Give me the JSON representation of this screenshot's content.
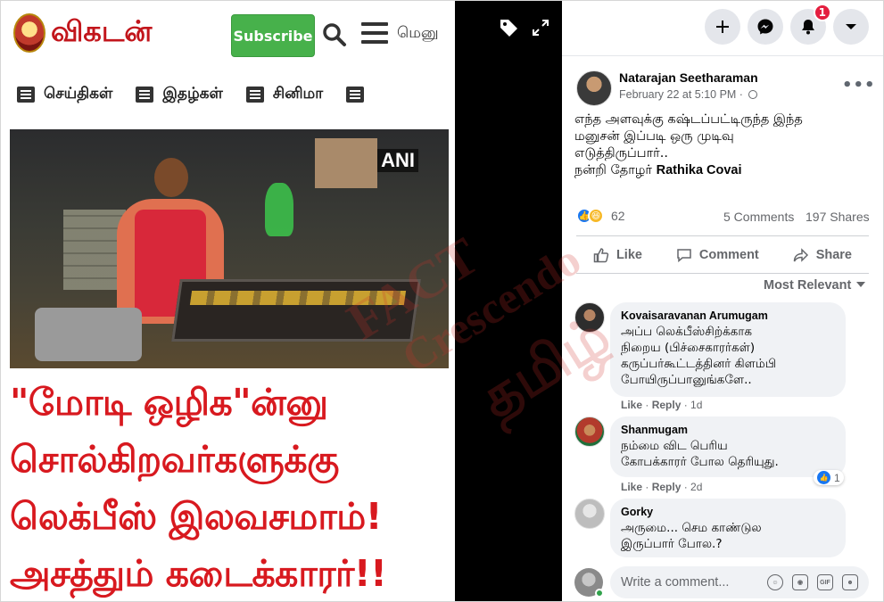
{
  "left_image": {
    "logo_text": "விகடன்",
    "subscribe_label": "Subscribe",
    "menu_label": "மெனு",
    "nav": [
      {
        "label": "செய்திகள்",
        "icon": "news-icon"
      },
      {
        "label": "இதழ்கள்",
        "icon": "book-icon"
      },
      {
        "label": "சினிமா",
        "icon": "film-icon"
      }
    ],
    "photo_credit": "ANI",
    "headline": [
      "\"மோடி ஒழிக\"ன்னு",
      "சொல்கிறவர்களுக்கு",
      "லெக்பீஸ் இலவசமாம்!",
      "அசத்தும் கடைக்காரர்!!"
    ],
    "headline_color": "#d8191f",
    "subscribe_color": "#47b14b"
  },
  "topbar": {
    "notifications_badge": "1",
    "buttons": [
      "plus-icon",
      "messenger-icon",
      "bell-icon",
      "caret-down-icon"
    ]
  },
  "post": {
    "author": "Natarajan Seetharaman",
    "time": "February 22 at 5:10 PM · ",
    "text_lines": [
      "எந்த அளவுக்கு கஷ்டப்பட்டிருந்த இந்த",
      "மனுசன் இப்படி ஒரு முடிவு",
      "எடுத்திருப்பார்.."
    ],
    "thanks_prefix": "நன்றி தோழர் ",
    "thanks_name": "Rathika Covai",
    "reactions_count": "62",
    "comments_count": "5 Comments",
    "shares_count": "197 Shares",
    "actions": {
      "like": "Like",
      "comment": "Comment",
      "share": "Share"
    },
    "sort_label": "Most Relevant",
    "accent_color": "#1877f2"
  },
  "comments": [
    {
      "name": "Kovaisaravanan Arumugam",
      "lines": [
        "அப்ப லெக்பீஸ்சிற்க்காக",
        "நிறைய (பிச்சைகாரர்கள்)",
        "கருப்பர்கூட்டத்தினர் கிளம்பி",
        "போயிருப்பானுங்களே.."
      ],
      "like": "Like",
      "reply": "Reply",
      "age": "1d"
    },
    {
      "name": "Shanmugam",
      "lines": [
        "நம்மை விட பெரிய",
        "கோபக்காரர் போல தெரியுது."
      ],
      "like": "Like",
      "reply": "Reply",
      "age": "2d",
      "reaction_count": "1"
    },
    {
      "name": "Gorky",
      "lines": [
        "அருமை... செம காண்டுல",
        "இருப்பார் போல.?"
      ]
    }
  ],
  "write_comment": {
    "placeholder": "Write a comment...",
    "icons": [
      "smiley-icon",
      "camera-icon",
      "gif-icon",
      "sticker-icon"
    ]
  },
  "watermark": {
    "line1": "FACT",
    "line2": "Crescendo",
    "line3": "தமிழ்"
  }
}
